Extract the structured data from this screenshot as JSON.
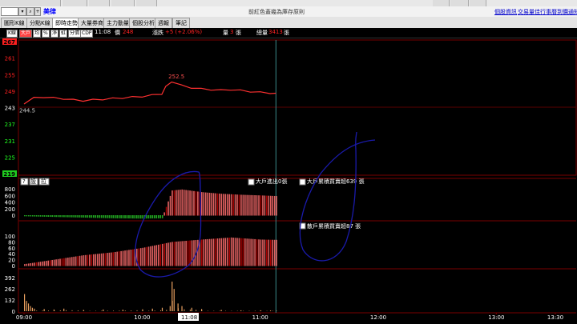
{
  "window": {
    "stock_name": "美律",
    "center_text": "前紅色蓋幾為庫存原則",
    "links": [
      "個股資訊",
      "交易量佳",
      "行事曆",
      "到價通知"
    ]
  },
  "tabs": [
    {
      "label": "圖形K線",
      "active": false
    },
    {
      "label": "分點K線",
      "active": false
    },
    {
      "label": "即時走勢",
      "active": true
    },
    {
      "label": "大量券商",
      "active": false
    },
    {
      "label": "主力動量",
      "active": false
    },
    {
      "label": "個股分析",
      "active": false
    },
    {
      "label": "週報",
      "active": false
    },
    {
      "label": "筆記",
      "active": false
    }
  ],
  "toolbar": {
    "buttons": [
      "K線",
      "大戶",
      "均",
      "%",
      "淨",
      "虹",
      "分價",
      "CDP"
    ],
    "time": "11:08",
    "price_label": "價",
    "price": "248",
    "change_label": "漲跌",
    "change": "+5 (+2.06%)",
    "volume_label": "量",
    "volume": "3",
    "volume_unit": "張",
    "total_label": "總量",
    "total": "3413",
    "total_unit": "張"
  },
  "lower_panel": {
    "buttons": [
      "?",
      "設",
      "拉"
    ],
    "net_big_label": "大戶進出0張",
    "cum_big_label": "大戶累積買賣超639 張",
    "cum_retail_label": "散戶累積買賣超87 張"
  },
  "colors": {
    "up": "#ff2020",
    "down": "#20ff20",
    "flat": "#ffffff",
    "price_line": "#ff3030",
    "bar_red": "#e06060",
    "bar_dark": "#aa0000",
    "bar_green": "#22aa22",
    "volume_bar": "#e8a060",
    "annotation": "#1a1aaa"
  },
  "chart_data": {
    "type": "line",
    "x_ticks": [
      "09:00",
      "10:00",
      "11:00",
      "12:00",
      "13:00",
      "13:30"
    ],
    "cursor_time": "11:08",
    "price": {
      "y_ticks": [
        267,
        261,
        255,
        249,
        243,
        237,
        231,
        225,
        219
      ],
      "reference": 243,
      "open_label": "244.5",
      "high_label": "252.5",
      "times": [
        "09:00",
        "09:05",
        "09:10",
        "09:15",
        "09:20",
        "09:25",
        "09:30",
        "09:35",
        "09:40",
        "09:45",
        "09:50",
        "09:55",
        "10:00",
        "10:05",
        "10:10",
        "10:12",
        "10:15",
        "10:20",
        "10:25",
        "10:30",
        "10:35",
        "10:40",
        "10:45",
        "10:50",
        "10:55",
        "11:00",
        "11:05",
        "11:08"
      ],
      "values": [
        244.5,
        246.5,
        246.8,
        246.5,
        246.2,
        245.8,
        245.5,
        245.8,
        246.0,
        246.3,
        246.5,
        246.8,
        247.0,
        247.5,
        248.0,
        250.5,
        252.5,
        251.0,
        250.2,
        249.8,
        249.5,
        249.3,
        249.5,
        249.2,
        248.8,
        248.5,
        248.3,
        248.0
      ]
    },
    "big_net": {
      "y_ticks": [
        800,
        600,
        400,
        200,
        0
      ],
      "times": [
        "09:00",
        "09:15",
        "09:30",
        "09:45",
        "10:00",
        "10:10",
        "10:15",
        "10:20",
        "10:30",
        "10:40",
        "10:50",
        "11:00",
        "11:08"
      ],
      "values": [
        -20,
        -40,
        -60,
        -80,
        -90,
        -80,
        750,
        780,
        700,
        650,
        620,
        600,
        580
      ]
    },
    "retail_cum": {
      "y_ticks": [
        100,
        80,
        60,
        40,
        20,
        0
      ],
      "times": [
        "09:00",
        "09:15",
        "09:30",
        "09:45",
        "10:00",
        "10:15",
        "10:30",
        "10:45",
        "11:00",
        "11:08"
      ],
      "values": [
        5,
        20,
        35,
        45,
        60,
        80,
        88,
        95,
        88,
        87
      ]
    },
    "volume": {
      "y_ticks": [
        392,
        262,
        132,
        0
      ],
      "times": [
        "09:00",
        "09:01",
        "09:02",
        "09:03",
        "09:04",
        "09:05",
        "09:10",
        "09:15",
        "09:20",
        "09:30",
        "09:40",
        "09:50",
        "10:00",
        "10:05",
        "10:10",
        "10:14",
        "10:15",
        "10:16",
        "10:18",
        "10:20",
        "10:25",
        "10:30",
        "10:40",
        "10:50",
        "11:00",
        "11:05",
        "11:08"
      ],
      "values": [
        200,
        120,
        90,
        60,
        40,
        30,
        25,
        20,
        30,
        15,
        20,
        18,
        22,
        30,
        40,
        60,
        345,
        260,
        90,
        60,
        40,
        25,
        15,
        10,
        10,
        8,
        5
      ]
    }
  }
}
